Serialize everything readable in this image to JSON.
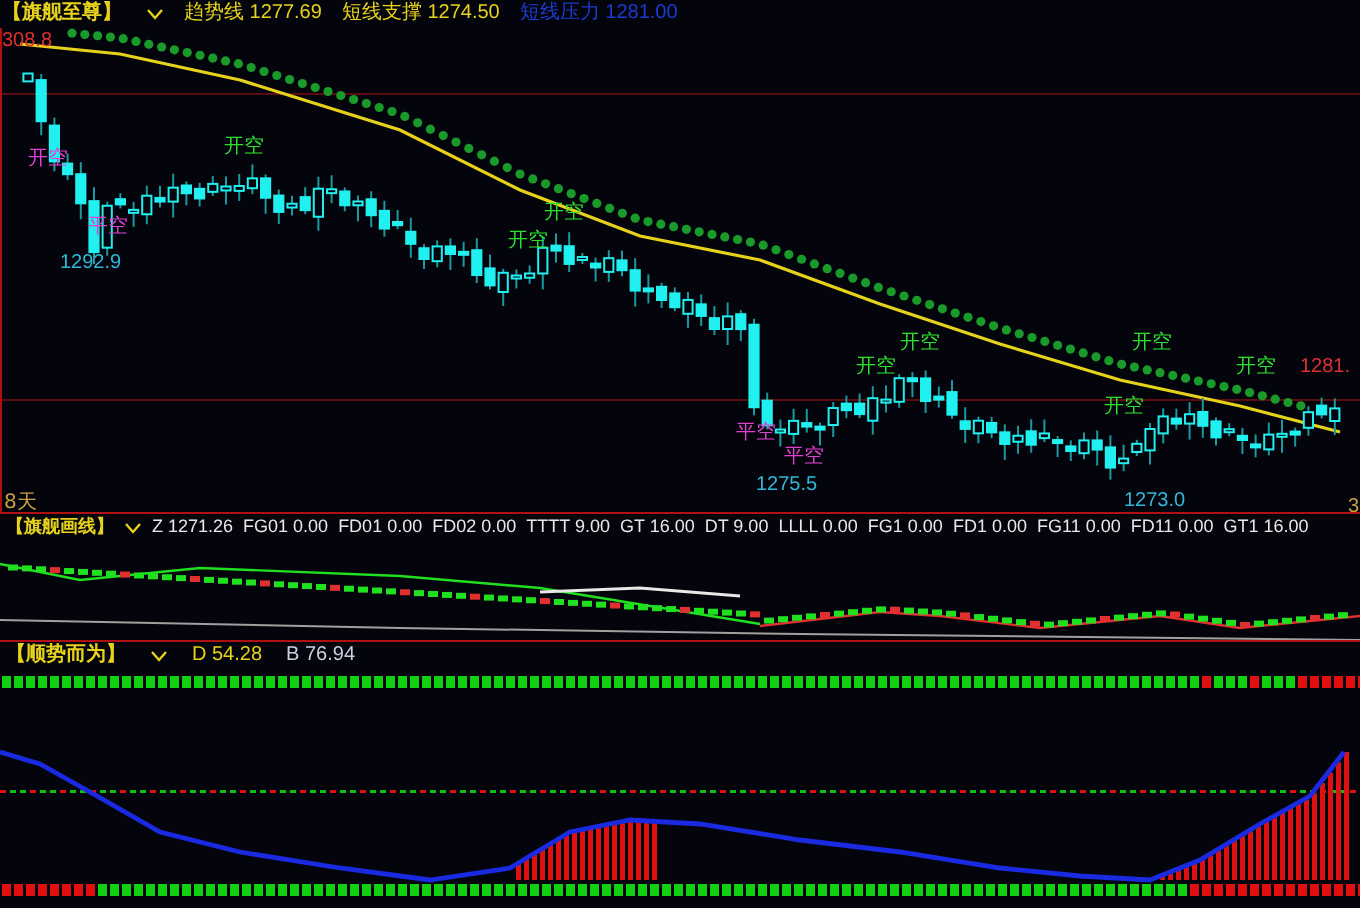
{
  "main_panel": {
    "title": "【旗舰至尊】",
    "legend": [
      {
        "label": "趋势线",
        "value": "1277.69",
        "color": "#e6d21a"
      },
      {
        "label": "短线支撑",
        "value": "1274.50",
        "color": "#e6d21a"
      },
      {
        "label": "短线压力",
        "value": "1281.00",
        "color": "#1a3cd0"
      }
    ],
    "top_price": "308.8",
    "signals": [
      {
        "kind": "close_short",
        "text": "开空"
      },
      {
        "kind": "close_short",
        "text": "平空"
      },
      {
        "kind": "open_short",
        "text": "开空"
      },
      {
        "kind": "open_short",
        "text": "开空"
      },
      {
        "kind": "open_short",
        "text": "开空"
      },
      {
        "kind": "close_short",
        "text": "平空"
      },
      {
        "kind": "close_short",
        "text": "平空"
      },
      {
        "kind": "open_short",
        "text": "开空"
      },
      {
        "kind": "open_short",
        "text": "开空"
      },
      {
        "kind": "open_short",
        "text": "开空"
      },
      {
        "kind": "open_short",
        "text": "开空"
      },
      {
        "kind": "open_short",
        "text": "开空"
      }
    ],
    "price_labels": [
      {
        "kind": "low",
        "text": "1292.9"
      },
      {
        "kind": "low",
        "text": "1275.5"
      },
      {
        "kind": "low",
        "text": "1273.0"
      },
      {
        "kind": "high",
        "text": "1281."
      }
    ],
    "period_label": "8天",
    "right_edge_label": "3"
  },
  "line_panel": {
    "title": "【旗舰画线】",
    "legend": [
      "Z 1271.26",
      "FG01 0.00",
      "FD01 0.00",
      "FD02 0.00",
      "TTTT 9.00",
      "GT 16.00",
      "DT 9.00",
      "LLLL 0.00",
      "FG1 0.00",
      "FD1 0.00",
      "FG11 0.00",
      "FD11 0.00",
      "GT1 16.00"
    ]
  },
  "trend_panel": {
    "title": "【顺势而为】",
    "legend": [
      {
        "text": "D 54.28",
        "color": "#e6d21a"
      },
      {
        "text": "B 76.94",
        "color": "#c8d0e0"
      }
    ]
  }
}
